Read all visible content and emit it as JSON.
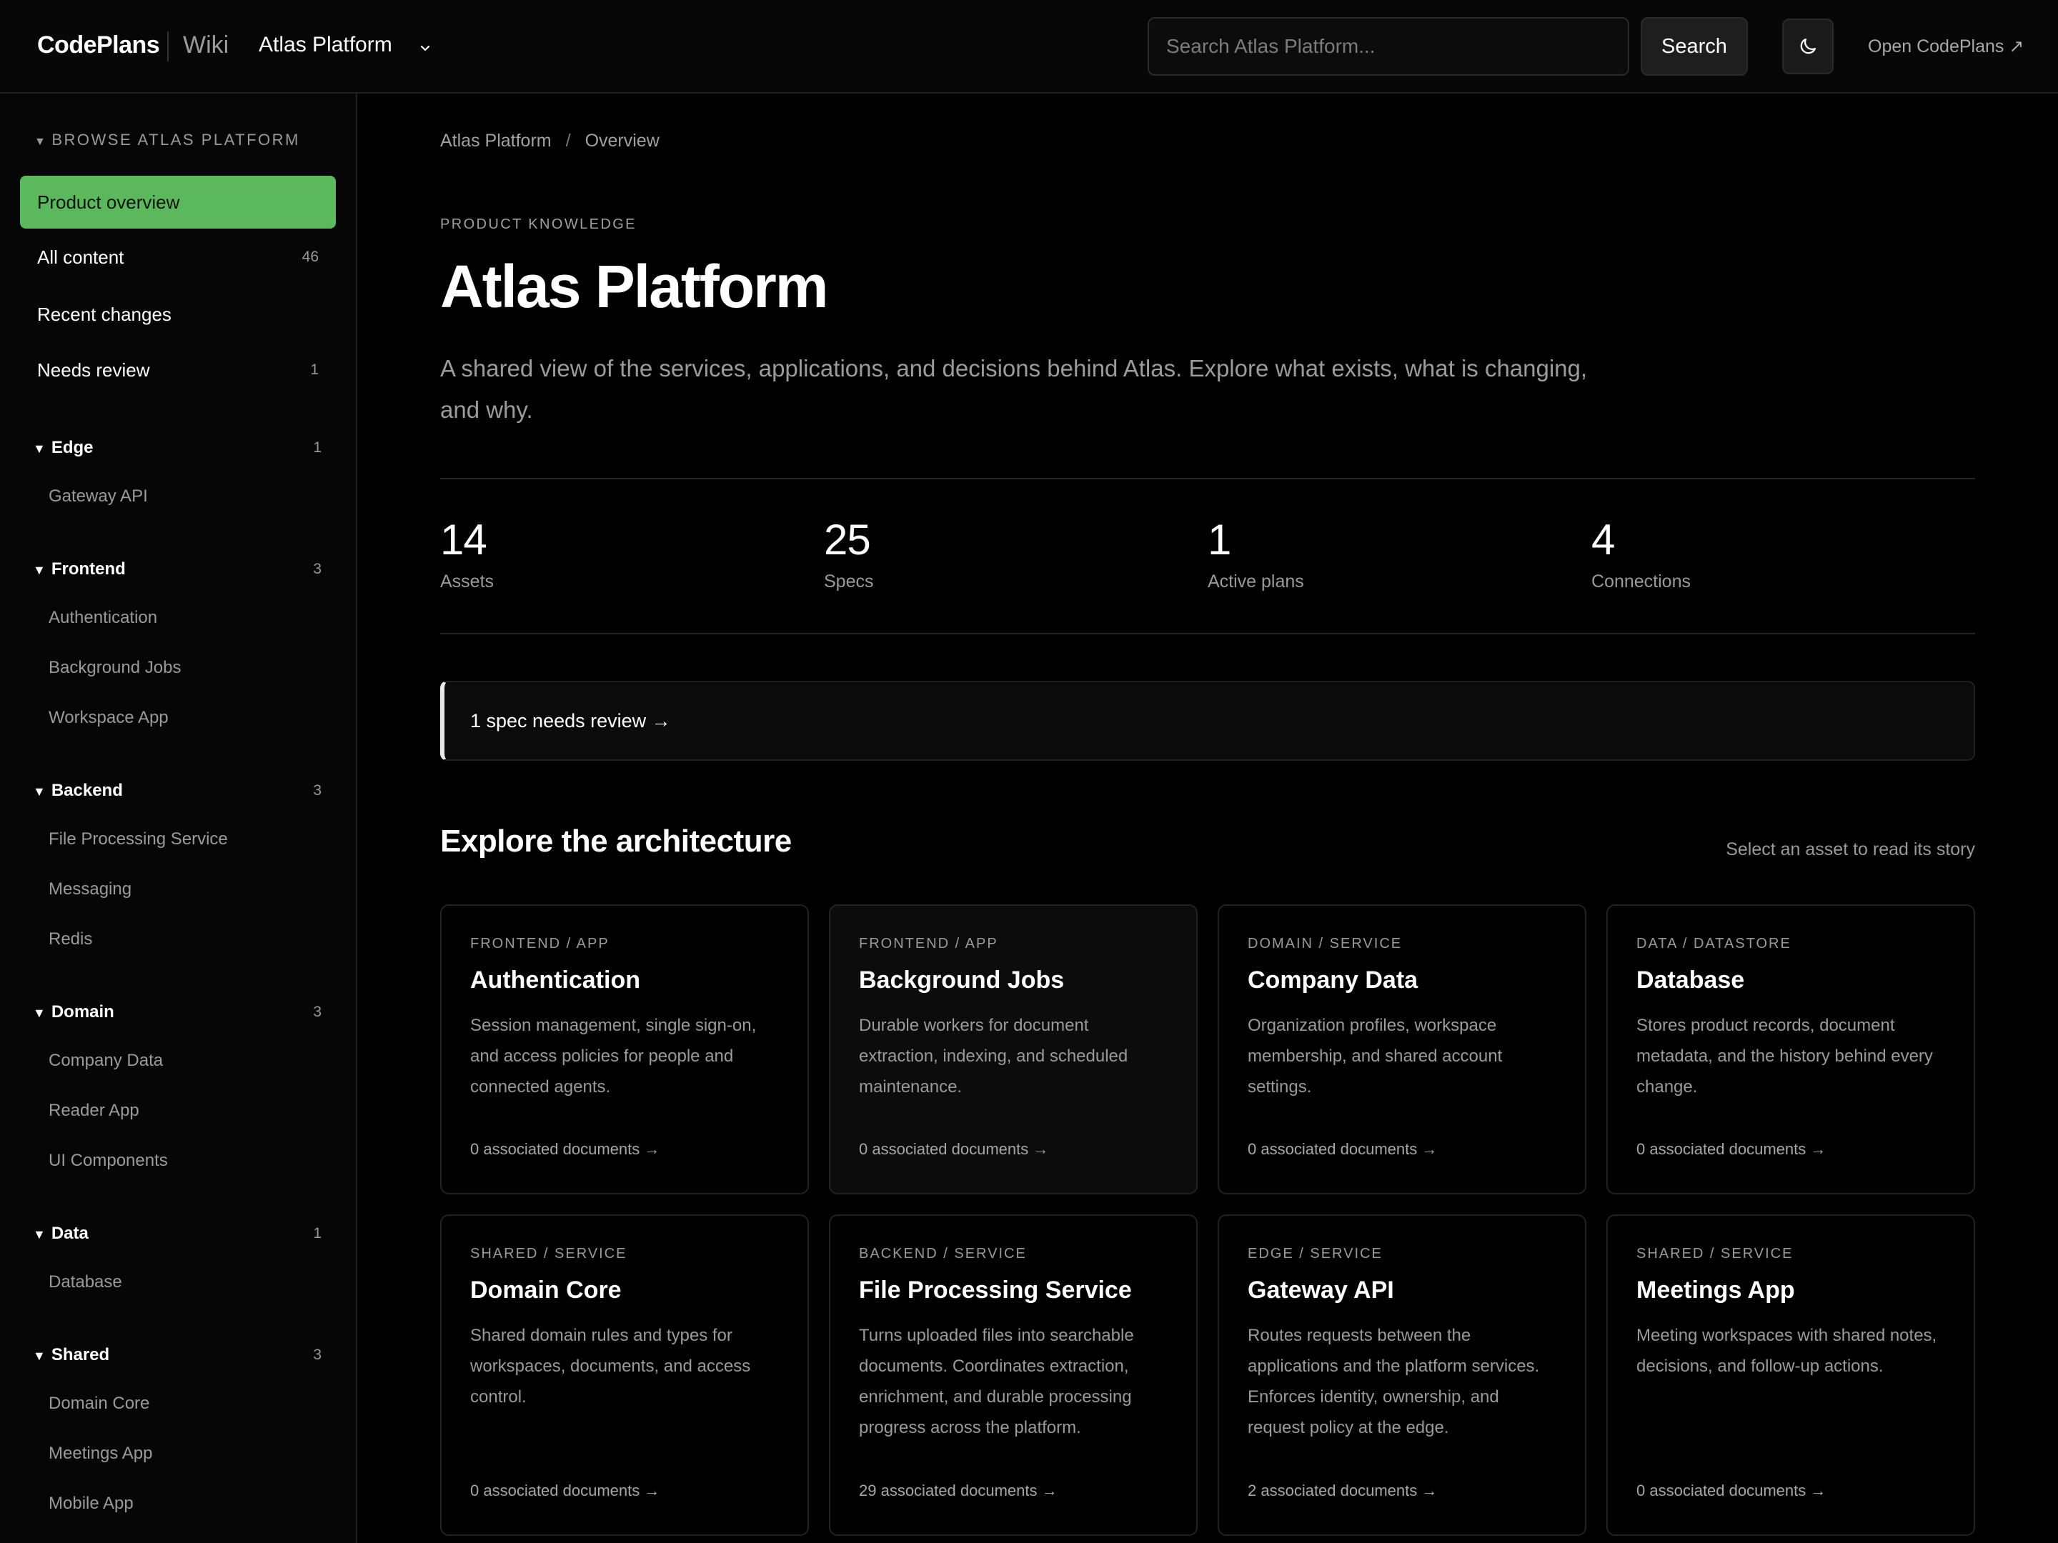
{
  "header": {
    "logo": "CodePlans",
    "section": "Wiki",
    "project": "Atlas Platform",
    "search_placeholder": "Search Atlas Platform...",
    "search_button": "Search",
    "open_link": "Open CodePlans ↗"
  },
  "sidebar": {
    "browse_label": "BROWSE ATLAS PLATFORM",
    "nav": [
      {
        "label": "Product overview",
        "count": ""
      },
      {
        "label": "All content",
        "count": "46"
      },
      {
        "label": "Recent changes",
        "count": ""
      },
      {
        "label": "Needs review",
        "count": "1"
      }
    ],
    "groups": [
      {
        "label": "Edge",
        "count": "1",
        "items": [
          "Gateway API"
        ]
      },
      {
        "label": "Frontend",
        "count": "3",
        "items": [
          "Authentication",
          "Background Jobs",
          "Workspace App"
        ]
      },
      {
        "label": "Backend",
        "count": "3",
        "items": [
          "File Processing Service",
          "Messaging",
          "Redis"
        ]
      },
      {
        "label": "Domain",
        "count": "3",
        "items": [
          "Company Data",
          "Reader App",
          "UI Components"
        ]
      },
      {
        "label": "Data",
        "count": "1",
        "items": [
          "Database"
        ]
      },
      {
        "label": "Shared",
        "count": "3",
        "items": [
          "Domain Core",
          "Meetings App",
          "Mobile App"
        ]
      }
    ]
  },
  "main": {
    "breadcrumb": [
      "Atlas Platform",
      "Overview"
    ],
    "breadcrumb_sep": "/",
    "eyebrow": "PRODUCT KNOWLEDGE",
    "title": "Atlas Platform",
    "lead": "A shared view of the services, applications, and decisions behind Atlas. Explore what exists, what is changing, and why.",
    "stats": [
      {
        "value": "14",
        "label": "Assets"
      },
      {
        "value": "25",
        "label": "Specs"
      },
      {
        "value": "1",
        "label": "Active plans"
      },
      {
        "value": "4",
        "label": "Connections"
      }
    ],
    "review_callout": "1 spec needs review →",
    "section_title": "Explore the architecture",
    "section_hint": "Select an asset to read its story",
    "cards": [
      {
        "eyebrow": "FRONTEND / APP",
        "title": "Authentication",
        "desc": "Session management, single sign-on, and access policies for people and connected agents.",
        "foot": "0 associated documents →"
      },
      {
        "eyebrow": "FRONTEND / APP",
        "title": "Background Jobs",
        "desc": "Durable workers for document extraction, indexing, and scheduled maintenance.",
        "foot": "0 associated documents →"
      },
      {
        "eyebrow": "DOMAIN / SERVICE",
        "title": "Company Data",
        "desc": "Organization profiles, workspace membership, and shared account settings.",
        "foot": "0 associated documents →"
      },
      {
        "eyebrow": "DATA / DATASTORE",
        "title": "Database",
        "desc": "Stores product records, document metadata, and the history behind every change.",
        "foot": "0 associated documents →"
      },
      {
        "eyebrow": "SHARED / SERVICE",
        "title": "Domain Core",
        "desc": "Shared domain rules and types for workspaces, documents, and access control.",
        "foot": "0 associated documents →"
      },
      {
        "eyebrow": "BACKEND / SERVICE",
        "title": "File Processing Service",
        "desc": "Turns uploaded files into searchable documents. Coordinates extraction, enrichment, and durable processing progress across the platform.",
        "foot": "29 associated documents →"
      },
      {
        "eyebrow": "EDGE / SERVICE",
        "title": "Gateway API",
        "desc": "Routes requests between the applications and the platform services. Enforces identity, ownership, and request policy at the edge.",
        "foot": "2 associated documents →"
      },
      {
        "eyebrow": "SHARED / SERVICE",
        "title": "Meetings App",
        "desc": "Meeting workspaces with shared notes, decisions, and follow-up actions.",
        "foot": "0 associated documents →"
      }
    ]
  },
  "colors": {
    "accent_green": "#5cb85c",
    "background": "#000000"
  },
  "icons": {
    "theme_toggle": "moon-icon",
    "project_switch": "chevron-down-icon"
  }
}
